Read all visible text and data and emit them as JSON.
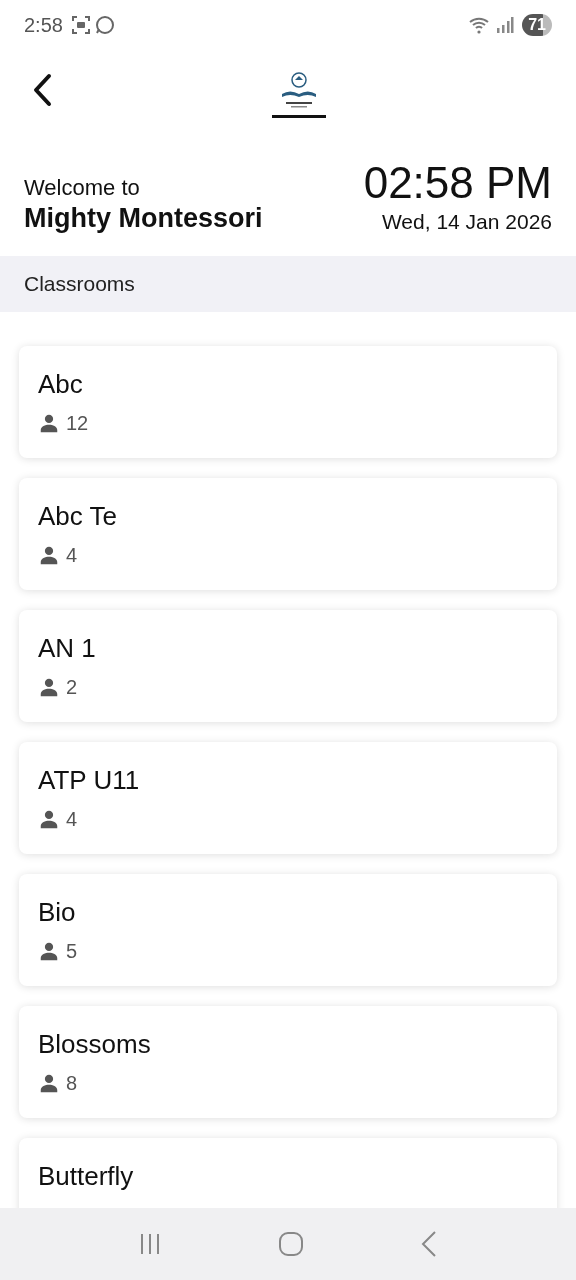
{
  "status_bar": {
    "time": "2:58",
    "battery": "71"
  },
  "welcome": {
    "greeting": "Welcome to",
    "school": "Mighty Montessori",
    "time": "02:58 PM",
    "date": "Wed, 14 Jan 2026"
  },
  "section_title": "Classrooms",
  "classrooms": [
    {
      "name": "Abc",
      "count": "12"
    },
    {
      "name": "Abc Te",
      "count": "4"
    },
    {
      "name": "AN 1",
      "count": "2"
    },
    {
      "name": "ATP U11",
      "count": "4"
    },
    {
      "name": "Bio",
      "count": "5"
    },
    {
      "name": "Blossoms",
      "count": "8"
    },
    {
      "name": "Butterfly"
    }
  ]
}
